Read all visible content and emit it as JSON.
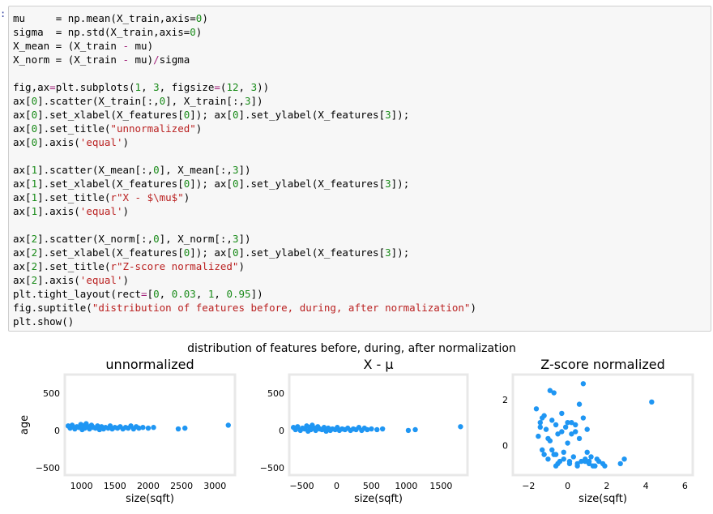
{
  "notebook": {
    "prompt": ":",
    "code_lines": [
      [
        {
          "t": "mu",
          "c": ""
        },
        {
          "t": "     = np.mean(X_train,axis=",
          "c": ""
        },
        {
          "t": "0",
          "c": "num"
        },
        {
          "t": ")",
          "c": ""
        }
      ],
      [
        {
          "t": "sigma",
          "c": ""
        },
        {
          "t": "  = np.std(X_train,axis=",
          "c": ""
        },
        {
          "t": "0",
          "c": "num"
        },
        {
          "t": ")",
          "c": ""
        }
      ],
      [
        {
          "t": "X_mean = (X_train ",
          "c": ""
        },
        {
          "t": "-",
          "c": "op"
        },
        {
          "t": " mu)",
          "c": ""
        }
      ],
      [
        {
          "t": "X_norm = (X_train ",
          "c": ""
        },
        {
          "t": "-",
          "c": "op"
        },
        {
          "t": " mu)",
          "c": ""
        },
        {
          "t": "/",
          "c": "op"
        },
        {
          "t": "sigma",
          "c": ""
        }
      ],
      [
        {
          "t": "",
          "c": ""
        }
      ],
      [
        {
          "t": "fig,ax",
          "c": ""
        },
        {
          "t": "=",
          "c": "op"
        },
        {
          "t": "plt.subplots(",
          "c": ""
        },
        {
          "t": "1",
          "c": "num"
        },
        {
          "t": ", ",
          "c": ""
        },
        {
          "t": "3",
          "c": "num"
        },
        {
          "t": ", figsize",
          "c": ""
        },
        {
          "t": "=",
          "c": "op"
        },
        {
          "t": "(",
          "c": ""
        },
        {
          "t": "12",
          "c": "num"
        },
        {
          "t": ", ",
          "c": ""
        },
        {
          "t": "3",
          "c": "num"
        },
        {
          "t": "))",
          "c": ""
        }
      ],
      [
        {
          "t": "ax[",
          "c": ""
        },
        {
          "t": "0",
          "c": "num"
        },
        {
          "t": "].scatter(X_train[:,",
          "c": ""
        },
        {
          "t": "0",
          "c": "num"
        },
        {
          "t": "], X_train[:,",
          "c": ""
        },
        {
          "t": "3",
          "c": "num"
        },
        {
          "t": "])",
          "c": ""
        }
      ],
      [
        {
          "t": "ax[",
          "c": ""
        },
        {
          "t": "0",
          "c": "num"
        },
        {
          "t": "].set_xlabel(X_features[",
          "c": ""
        },
        {
          "t": "0",
          "c": "num"
        },
        {
          "t": "]); ax[",
          "c": ""
        },
        {
          "t": "0",
          "c": "num"
        },
        {
          "t": "].set_ylabel(X_features[",
          "c": ""
        },
        {
          "t": "3",
          "c": "num"
        },
        {
          "t": "]);",
          "c": ""
        }
      ],
      [
        {
          "t": "ax[",
          "c": ""
        },
        {
          "t": "0",
          "c": "num"
        },
        {
          "t": "].set_title(",
          "c": ""
        },
        {
          "t": "\"unnormalized\"",
          "c": "str"
        },
        {
          "t": ")",
          "c": ""
        }
      ],
      [
        {
          "t": "ax[",
          "c": ""
        },
        {
          "t": "0",
          "c": "num"
        },
        {
          "t": "].axis(",
          "c": ""
        },
        {
          "t": "'equal'",
          "c": "str"
        },
        {
          "t": ")",
          "c": ""
        }
      ],
      [
        {
          "t": "",
          "c": ""
        }
      ],
      [
        {
          "t": "ax[",
          "c": ""
        },
        {
          "t": "1",
          "c": "num"
        },
        {
          "t": "].scatter(X_mean[:,",
          "c": ""
        },
        {
          "t": "0",
          "c": "num"
        },
        {
          "t": "], X_mean[:,",
          "c": ""
        },
        {
          "t": "3",
          "c": "num"
        },
        {
          "t": "])",
          "c": ""
        }
      ],
      [
        {
          "t": "ax[",
          "c": ""
        },
        {
          "t": "1",
          "c": "num"
        },
        {
          "t": "].set_xlabel(X_features[",
          "c": ""
        },
        {
          "t": "0",
          "c": "num"
        },
        {
          "t": "]); ax[",
          "c": ""
        },
        {
          "t": "0",
          "c": "num"
        },
        {
          "t": "].set_ylabel(X_features[",
          "c": ""
        },
        {
          "t": "3",
          "c": "num"
        },
        {
          "t": "]);",
          "c": ""
        }
      ],
      [
        {
          "t": "ax[",
          "c": ""
        },
        {
          "t": "1",
          "c": "num"
        },
        {
          "t": "].set_title(",
          "c": ""
        },
        {
          "t": "r\"X - $\\mu$\"",
          "c": "str"
        },
        {
          "t": ")",
          "c": ""
        }
      ],
      [
        {
          "t": "ax[",
          "c": ""
        },
        {
          "t": "1",
          "c": "num"
        },
        {
          "t": "].axis(",
          "c": ""
        },
        {
          "t": "'equal'",
          "c": "str"
        },
        {
          "t": ")",
          "c": ""
        }
      ],
      [
        {
          "t": "",
          "c": ""
        }
      ],
      [
        {
          "t": "ax[",
          "c": ""
        },
        {
          "t": "2",
          "c": "num"
        },
        {
          "t": "].scatter(X_norm[:,",
          "c": ""
        },
        {
          "t": "0",
          "c": "num"
        },
        {
          "t": "], X_norm[:,",
          "c": ""
        },
        {
          "t": "3",
          "c": "num"
        },
        {
          "t": "])",
          "c": ""
        }
      ],
      [
        {
          "t": "ax[",
          "c": ""
        },
        {
          "t": "2",
          "c": "num"
        },
        {
          "t": "].set_xlabel(X_features[",
          "c": ""
        },
        {
          "t": "0",
          "c": "num"
        },
        {
          "t": "]); ax[",
          "c": ""
        },
        {
          "t": "0",
          "c": "num"
        },
        {
          "t": "].set_ylabel(X_features[",
          "c": ""
        },
        {
          "t": "3",
          "c": "num"
        },
        {
          "t": "]);",
          "c": ""
        }
      ],
      [
        {
          "t": "ax[",
          "c": ""
        },
        {
          "t": "2",
          "c": "num"
        },
        {
          "t": "].set_title(",
          "c": ""
        },
        {
          "t": "r\"Z-score normalized\"",
          "c": "str"
        },
        {
          "t": ")",
          "c": ""
        }
      ],
      [
        {
          "t": "ax[",
          "c": ""
        },
        {
          "t": "2",
          "c": "num"
        },
        {
          "t": "].axis(",
          "c": ""
        },
        {
          "t": "'equal'",
          "c": "str"
        },
        {
          "t": ")",
          "c": ""
        }
      ],
      [
        {
          "t": "plt.tight_layout(rect",
          "c": ""
        },
        {
          "t": "=",
          "c": "op"
        },
        {
          "t": "[",
          "c": ""
        },
        {
          "t": "0",
          "c": "num"
        },
        {
          "t": ", ",
          "c": ""
        },
        {
          "t": "0.03",
          "c": "num"
        },
        {
          "t": ", ",
          "c": ""
        },
        {
          "t": "1",
          "c": "num"
        },
        {
          "t": ", ",
          "c": ""
        },
        {
          "t": "0.95",
          "c": "num"
        },
        {
          "t": "])",
          "c": ""
        }
      ],
      [
        {
          "t": "fig.suptitle(",
          "c": ""
        },
        {
          "t": "\"distribution of features before, during, after normalization\"",
          "c": "str"
        },
        {
          "t": ")",
          "c": ""
        }
      ],
      [
        {
          "t": "plt.show()",
          "c": ""
        }
      ]
    ]
  },
  "figure": {
    "suptitle": "distribution of features before, during, after normalization",
    "marker_color": "#1f96f3",
    "frame_color": "#e8e8e8",
    "ylabel": "age",
    "panels": [
      {
        "title": "unnormalized",
        "xlabel": "size(sqft)",
        "xlim": [
          750,
          3300
        ],
        "ylim": [
          -600,
          750
        ],
        "xticks": [
          {
            "v": 1000,
            "label": "1000"
          },
          {
            "v": 1500,
            "label": "1500"
          },
          {
            "v": 2000,
            "label": "2000"
          },
          {
            "v": 2500,
            "label": "2500"
          },
          {
            "v": 3000,
            "label": "3000"
          }
        ],
        "yticks": [
          {
            "v": 500,
            "label": "500"
          },
          {
            "v": 0,
            "label": "0"
          },
          {
            "v": -500,
            "label": "−500"
          }
        ]
      },
      {
        "title": "X - μ",
        "xlabel": "size(sqft)",
        "xlim": [
          -680,
          1880
        ],
        "ylim": [
          -600,
          750
        ],
        "xticks": [
          {
            "v": -500,
            "label": "−500"
          },
          {
            "v": 0,
            "label": "0"
          },
          {
            "v": 500,
            "label": "500"
          },
          {
            "v": 1000,
            "label": "1000"
          },
          {
            "v": 1500,
            "label": "1500"
          }
        ],
        "yticks": [
          {
            "v": 500,
            "label": "500"
          },
          {
            "v": 0,
            "label": "0"
          },
          {
            "v": -500,
            "label": "−500"
          }
        ]
      },
      {
        "title": "Z-score normalized",
        "xlabel": "size(sqft)",
        "xlim": [
          -2.8,
          6.4
        ],
        "ylim": [
          -1.3,
          3.1
        ],
        "xticks": [
          {
            "v": -2,
            "label": "−2"
          },
          {
            "v": 0,
            "label": "0"
          },
          {
            "v": 2,
            "label": "2"
          },
          {
            "v": 4,
            "label": "4"
          },
          {
            "v": 6,
            "label": "6"
          }
        ],
        "yticks": [
          {
            "v": 2,
            "label": "2"
          },
          {
            "v": 0,
            "label": "0"
          }
        ]
      }
    ]
  },
  "chart_data": [
    {
      "type": "scatter",
      "title": "unnormalized",
      "xlabel": "size(sqft)",
      "ylabel": "age",
      "xlim": [
        750,
        3300
      ],
      "ylim": [
        -600,
        750
      ],
      "x": [
        800,
        830,
        860,
        900,
        930,
        960,
        990,
        1010,
        1030,
        1050,
        1070,
        1100,
        1120,
        1150,
        1180,
        1210,
        1240,
        1270,
        1300,
        1330,
        1360,
        1400,
        1430,
        1460,
        1500,
        1540,
        1580,
        1620,
        1660,
        1700,
        1740,
        1780,
        1820,
        1860,
        1920,
        2000,
        2080,
        2450,
        2550,
        3200
      ],
      "y": [
        60,
        30,
        70,
        20,
        50,
        40,
        80,
        10,
        60,
        30,
        90,
        50,
        20,
        70,
        40,
        30,
        60,
        10,
        50,
        20,
        40,
        30,
        60,
        20,
        40,
        30,
        50,
        20,
        40,
        30,
        60,
        20,
        50,
        30,
        40,
        30,
        40,
        20,
        30,
        70
      ]
    },
    {
      "type": "scatter",
      "title": "X - μ",
      "xlabel": "size(sqft)",
      "ylabel": "age",
      "xlim": [
        -680,
        1880
      ],
      "ylim": [
        -600,
        750
      ],
      "x": [
        -620,
        -590,
        -560,
        -520,
        -490,
        -460,
        -430,
        -410,
        -390,
        -370,
        -350,
        -320,
        -300,
        -270,
        -240,
        -210,
        -180,
        -150,
        -120,
        -90,
        -60,
        -20,
        10,
        40,
        80,
        120,
        160,
        200,
        240,
        280,
        320,
        360,
        400,
        440,
        500,
        580,
        660,
        1030,
        1130,
        1780
      ],
      "y": [
        40,
        10,
        50,
        0,
        30,
        20,
        60,
        -10,
        40,
        10,
        70,
        30,
        0,
        50,
        20,
        10,
        40,
        -10,
        30,
        0,
        20,
        10,
        40,
        0,
        20,
        10,
        30,
        0,
        20,
        10,
        40,
        0,
        30,
        10,
        20,
        10,
        20,
        0,
        10,
        50
      ]
    },
    {
      "type": "scatter",
      "title": "Z-score normalized",
      "xlabel": "size(sqft)",
      "ylabel": "age",
      "xlim": [
        -2.8,
        6.4
      ],
      "ylim": [
        -1.3,
        3.1
      ],
      "x": [
        -1.6,
        -1.5,
        -1.4,
        -1.3,
        -1.2,
        -1.1,
        -1.0,
        -0.9,
        -0.8,
        -0.7,
        -0.6,
        -0.5,
        -0.4,
        -0.3,
        -0.2,
        -0.1,
        0.0,
        0.1,
        0.2,
        0.3,
        0.4,
        0.5,
        0.6,
        0.7,
        0.8,
        0.9,
        1.0,
        1.1,
        1.2,
        1.4,
        1.6,
        1.8,
        2.7,
        2.9,
        4.3,
        -0.9,
        -0.7,
        0.8,
        -1.3,
        -0.6,
        0.1,
        0.4,
        -1.0,
        -0.2,
        0.6,
        1.0,
        -1.4,
        -0.5,
        0.2,
        1.3,
        -0.8,
        0.0,
        0.9,
        1.5,
        -1.2,
        -0.3,
        0.5,
        1.1,
        1.9,
        -0.6
      ],
      "y": [
        1.6,
        0.4,
        1.0,
        -0.2,
        1.3,
        0.7,
        -0.6,
        0.2,
        1.1,
        -0.4,
        0.9,
        0.5,
        -0.7,
        1.4,
        -0.3,
        0.8,
        0.1,
        -0.8,
        1.0,
        -0.5,
        0.6,
        -0.9,
        0.3,
        -0.7,
        1.2,
        -0.6,
        0.7,
        -0.8,
        -0.5,
        -0.9,
        -0.7,
        -0.8,
        -0.8,
        -0.6,
        1.9,
        2.4,
        2.3,
        2.7,
        1.2,
        -0.4,
        -0.7,
        0.9,
        0.3,
        -0.6,
        1.8,
        -0.3,
        0.8,
        -0.8,
        0.5,
        -0.9,
        -0.2,
        1.0,
        -0.7,
        -0.6,
        -0.4,
        0.6,
        -0.8,
        -0.7,
        -0.9,
        -0.9
      ]
    }
  ]
}
